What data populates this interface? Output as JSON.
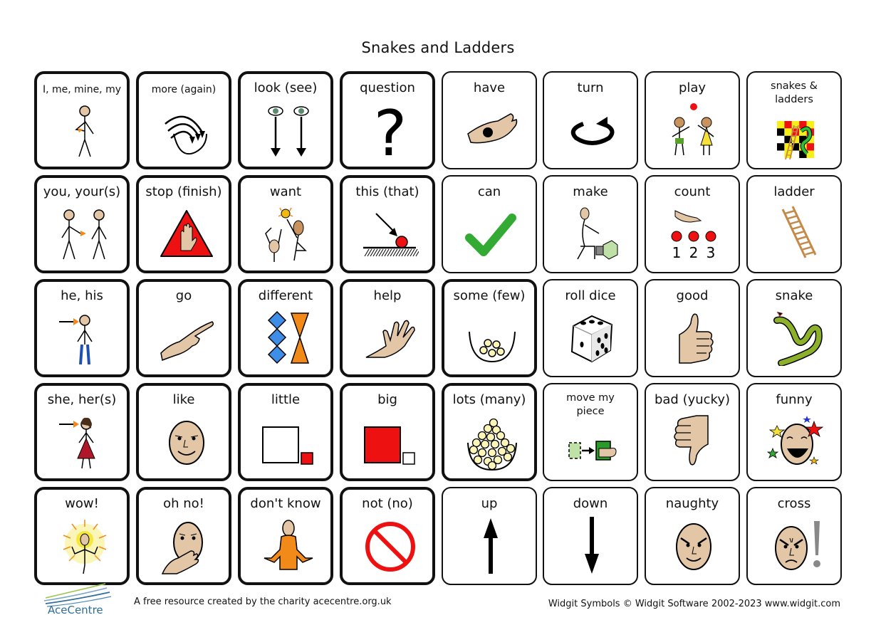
{
  "page": {
    "title": "Snakes and Ladders"
  },
  "cells": [
    {
      "label": "I, me, mine, my",
      "symbol": "person-self-icon",
      "border": "thick"
    },
    {
      "label": "more (again)",
      "symbol": "more-arrows-icon",
      "border": "thick"
    },
    {
      "label": "look (see)",
      "symbol": "eyes-icon",
      "border": "thick"
    },
    {
      "label": "question",
      "symbol": "question-mark-icon",
      "border": "thick"
    },
    {
      "label": "have",
      "symbol": "hand-holding-icon",
      "border": "thin"
    },
    {
      "label": "turn",
      "symbol": "turn-arrow-icon",
      "border": "thin"
    },
    {
      "label": "play",
      "symbol": "children-playing-icon",
      "border": "thin"
    },
    {
      "label": "snakes & ladders",
      "symbol": "snakes-ladders-board-icon",
      "border": "thin"
    },
    {
      "label": "you, your(s)",
      "symbol": "person-you-icon",
      "border": "thick"
    },
    {
      "label": "stop (finish)",
      "symbol": "stop-hand-icon",
      "border": "thick"
    },
    {
      "label": "want",
      "symbol": "want-reach-icon",
      "border": "thick"
    },
    {
      "label": "this (that)",
      "symbol": "this-pointer-icon",
      "border": "thick"
    },
    {
      "label": "can",
      "symbol": "checkmark-icon",
      "border": "thin"
    },
    {
      "label": "make",
      "symbol": "make-person-icon",
      "border": "thin"
    },
    {
      "label": "count",
      "symbol": "count-dots-icon",
      "border": "thin"
    },
    {
      "label": "ladder",
      "symbol": "ladder-icon",
      "border": "thin"
    },
    {
      "label": "he, his",
      "symbol": "person-he-icon",
      "border": "thick"
    },
    {
      "label": "go",
      "symbol": "pointing-hand-icon",
      "border": "thick"
    },
    {
      "label": "different",
      "symbol": "different-shapes-icon",
      "border": "thick"
    },
    {
      "label": "help",
      "symbol": "helping-hand-icon",
      "border": "thick"
    },
    {
      "label": "some (few)",
      "symbol": "bowl-few-icon",
      "border": "thick"
    },
    {
      "label": "roll dice",
      "symbol": "dice-icon",
      "border": "thin"
    },
    {
      "label": "good",
      "symbol": "thumbs-up-icon",
      "border": "thin"
    },
    {
      "label": "snake",
      "symbol": "snake-icon",
      "border": "thin"
    },
    {
      "label": "she, her(s)",
      "symbol": "person-she-icon",
      "border": "thick"
    },
    {
      "label": "like",
      "symbol": "smiling-face-icon",
      "border": "thick"
    },
    {
      "label": "little",
      "symbol": "little-square-icon",
      "border": "thick"
    },
    {
      "label": "big",
      "symbol": "big-square-icon",
      "border": "thick"
    },
    {
      "label": "lots (many)",
      "symbol": "bowl-many-icon",
      "border": "thick"
    },
    {
      "label": "move my piece",
      "symbol": "move-piece-icon",
      "border": "thin"
    },
    {
      "label": "bad (yucky)",
      "symbol": "thumbs-down-icon",
      "border": "thin"
    },
    {
      "label": "funny",
      "symbol": "laughing-face-icon",
      "border": "thin"
    },
    {
      "label": "wow!",
      "symbol": "wow-person-icon",
      "border": "thick"
    },
    {
      "label": "oh no!",
      "symbol": "oh-no-face-icon",
      "border": "thick"
    },
    {
      "label": "don't know",
      "symbol": "shrug-icon",
      "border": "thick"
    },
    {
      "label": "not (no)",
      "symbol": "prohibited-icon",
      "border": "thick"
    },
    {
      "label": "up",
      "symbol": "arrow-up-icon",
      "border": "thin"
    },
    {
      "label": "down",
      "symbol": "arrow-down-icon",
      "border": "thin"
    },
    {
      "label": "naughty",
      "symbol": "naughty-face-icon",
      "border": "thin"
    },
    {
      "label": "cross",
      "symbol": "cross-face-icon",
      "border": "thin"
    }
  ],
  "footer": {
    "logo_text": "AceCentre",
    "left_text": "A free resource created by the charity acecentre.org.uk",
    "right_text": "Widgit Symbols © Widgit Software 2002-2023  www.widgit.com"
  },
  "colors": {
    "skin": "#e2c6a6",
    "red": "#ee1111",
    "green": "#33aa33",
    "blue": "#3e8ee8",
    "orange": "#f28a1a",
    "snake_green": "#8db02a",
    "pale_yellow": "#fbf6b8"
  }
}
